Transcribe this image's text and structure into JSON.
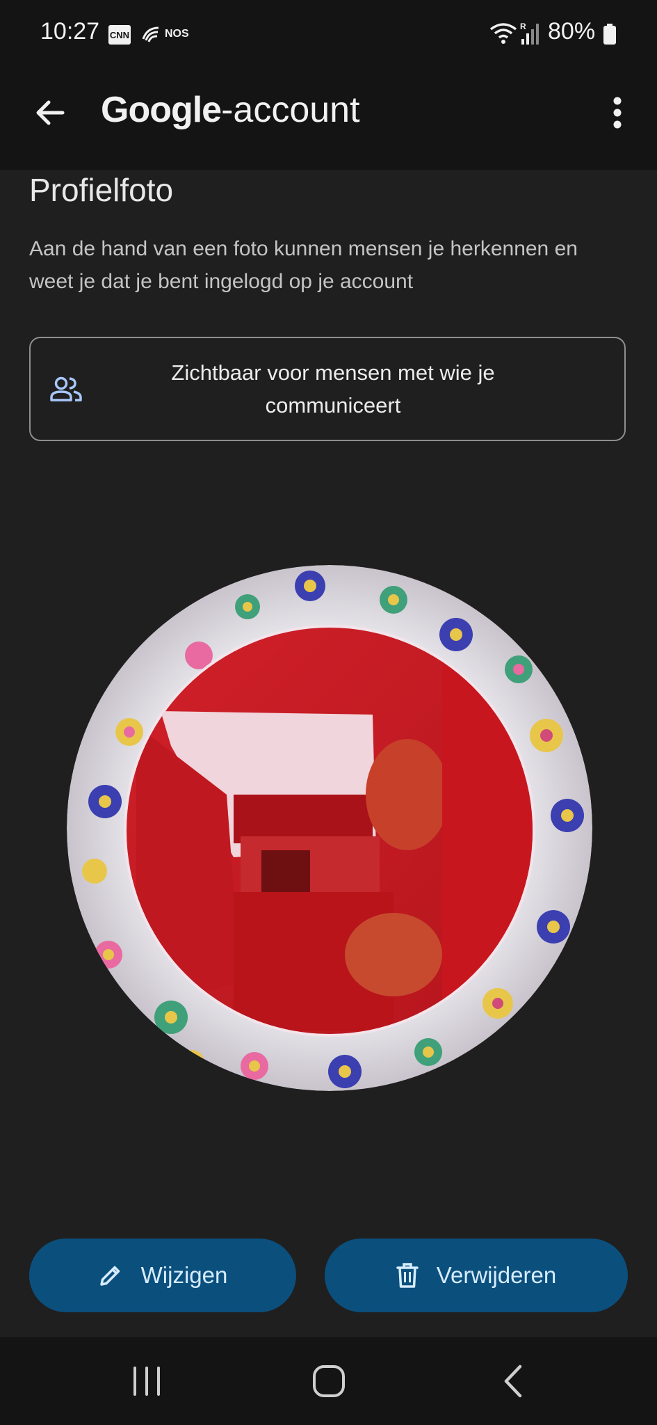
{
  "status_bar": {
    "time": "10:27",
    "cnn_label": "CNN",
    "nos_label": "NOS",
    "network_label": "R",
    "battery": "80%"
  },
  "app_bar": {
    "title_brand": "Google",
    "title_suffix": "-account",
    "back_icon": "arrow-back-icon",
    "more_icon": "more-vert-icon"
  },
  "profile": {
    "title": "Profielfoto",
    "description": "Aan de hand van een foto kunnen mensen je herkennen en weet je dat je bent ingelogd op je account",
    "visibility": {
      "icon": "people-icon",
      "label": "Zichtbaar voor mensen met wie je communiceert"
    }
  },
  "actions": {
    "edit_label": "Wijzigen",
    "edit_icon": "pencil-icon",
    "delete_label": "Verwijderen",
    "delete_icon": "trash-icon"
  },
  "nav": {
    "recent_icon": "recent-apps-icon",
    "home_icon": "home-icon",
    "back_icon": "nav-back-icon"
  },
  "colors": {
    "background": "#1f1f1f",
    "bar_background": "#141414",
    "button_background": "#0b4f7d",
    "button_text": "#d6ecff",
    "people_icon": "#a8c7fa"
  }
}
